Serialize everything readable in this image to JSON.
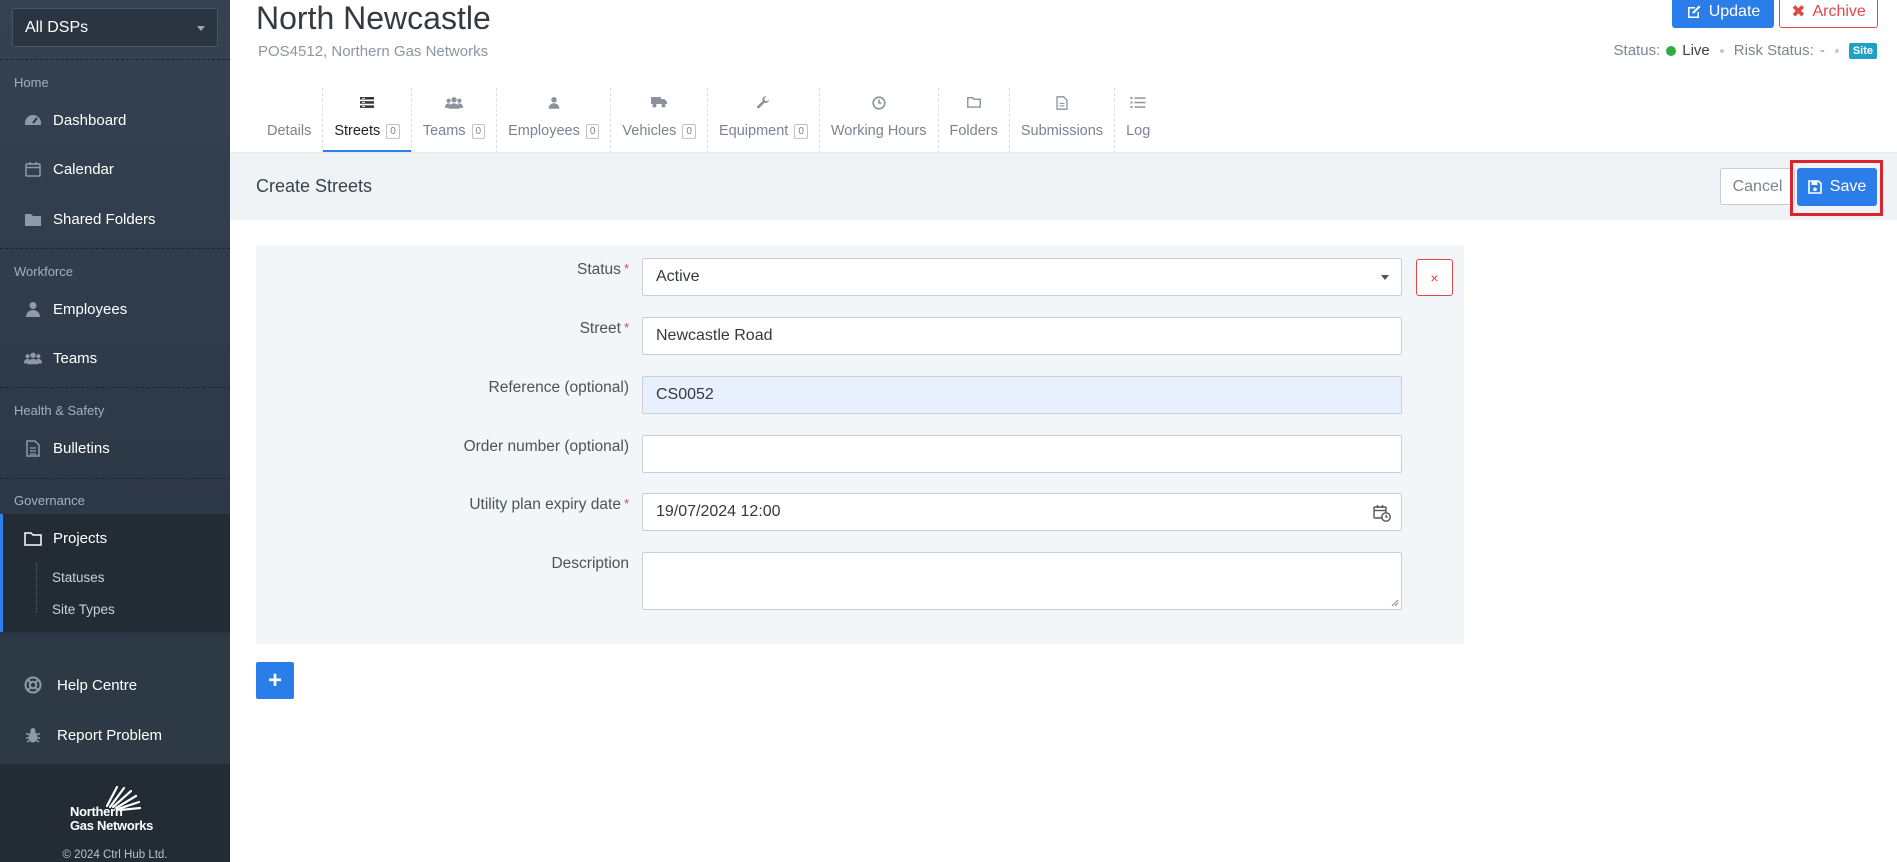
{
  "sidebar": {
    "dsp_select": "All DSPs",
    "sections": {
      "home": "Home",
      "workforce": "Workforce",
      "health_safety": "Health & Safety",
      "governance": "Governance"
    },
    "items": {
      "dashboard": "Dashboard",
      "calendar": "Calendar",
      "shared_folders": "Shared Folders",
      "employees": "Employees",
      "teams": "Teams",
      "bulletins": "Bulletins",
      "projects": "Projects",
      "statuses": "Statuses",
      "site_types": "Site Types",
      "help_centre": "Help Centre",
      "report_problem": "Report Problem"
    },
    "logo_line1": "Northern",
    "logo_line2": "Gas Networks",
    "copyright": "© 2024 Ctrl Hub Ltd."
  },
  "header": {
    "title": "North Newcastle",
    "subtitle": "POS4512, Northern Gas Networks",
    "update_label": "Update",
    "archive_label": "Archive",
    "status_label": "Status:",
    "status_value": "Live",
    "risk_label": "Risk Status:",
    "risk_value": "-",
    "site_badge": "Site",
    "status_color": "#2eab45"
  },
  "tabs": [
    {
      "label": "Details",
      "count": null,
      "icon": "none"
    },
    {
      "label": "Streets",
      "count": "0",
      "icon": "streets-icon",
      "active": true
    },
    {
      "label": "Teams",
      "count": "0",
      "icon": "users-icon"
    },
    {
      "label": "Employees",
      "count": "0",
      "icon": "user-icon"
    },
    {
      "label": "Vehicles",
      "count": "0",
      "icon": "truck-icon"
    },
    {
      "label": "Equipment",
      "count": "0",
      "icon": "wrench-icon"
    },
    {
      "label": "Working Hours",
      "count": null,
      "icon": "clock-icon"
    },
    {
      "label": "Folders",
      "count": null,
      "icon": "folder-icon"
    },
    {
      "label": "Submissions",
      "count": null,
      "icon": "document-icon"
    },
    {
      "label": "Log",
      "count": null,
      "icon": "list-icon"
    }
  ],
  "create": {
    "title": "Create Streets",
    "cancel_label": "Cancel",
    "save_label": "Save"
  },
  "form": {
    "status_label": "Status",
    "status_value": "Active",
    "street_label": "Street",
    "street_value": "Newcastle Road",
    "reference_label": "Reference (optional)",
    "reference_value": "CS0052",
    "order_label": "Order number (optional)",
    "order_value": "",
    "expiry_label": "Utility plan expiry date",
    "expiry_value": "19/07/2024 12:00",
    "description_label": "Description",
    "description_value": "",
    "remove_label": "×",
    "add_label": "+",
    "required_mark": "*"
  },
  "colors": {
    "accent": "#2b7de9",
    "danger": "#e04848",
    "sidebar_bg": "#2d3846"
  }
}
